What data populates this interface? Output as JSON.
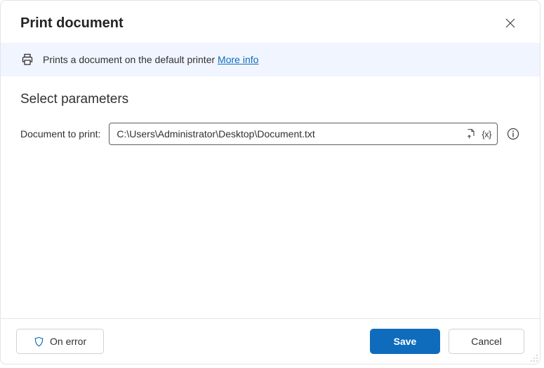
{
  "dialog": {
    "title": "Print document"
  },
  "banner": {
    "text": "Prints a document on the default printer ",
    "link": "More info"
  },
  "section": {
    "title": "Select parameters"
  },
  "param": {
    "label": "Document to print:",
    "value": "C:\\Users\\Administrator\\Desktop\\Document.txt",
    "variable_symbol": "{x}"
  },
  "footer": {
    "on_error": "On error",
    "save": "Save",
    "cancel": "Cancel"
  }
}
